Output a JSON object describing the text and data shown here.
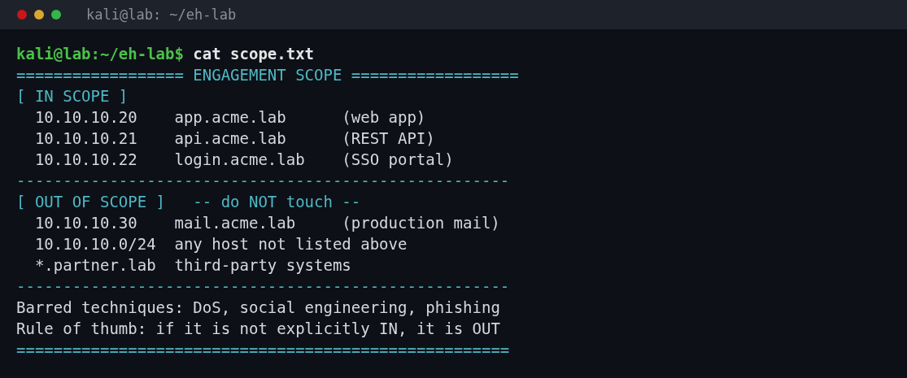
{
  "window": {
    "title": "kali@lab: ~/eh-lab"
  },
  "lines": [
    {
      "kind": "prompt",
      "prompt": "kali@lab:~/eh-lab$",
      "command": "cat scope.txt"
    },
    {
      "kind": "rule",
      "text": "================== ENGAGEMENT SCOPE =================="
    },
    {
      "kind": "heading",
      "text": "[ IN SCOPE ]"
    },
    {
      "kind": "entry",
      "ip": "10.10.10.20",
      "host": "app.acme.lab",
      "note": "(web app)"
    },
    {
      "kind": "entry",
      "ip": "10.10.10.21",
      "host": "api.acme.lab",
      "note": "(REST API)"
    },
    {
      "kind": "entry",
      "ip": "10.10.10.22",
      "host": "login.acme.lab",
      "note": "(SSO portal)"
    },
    {
      "kind": "rule",
      "text": "-----------------------------------------------------"
    },
    {
      "kind": "heading",
      "text": "[ OUT OF SCOPE ]",
      "note": "-- do NOT touch --"
    },
    {
      "kind": "entry",
      "ip": "10.10.10.30",
      "host": "mail.acme.lab",
      "note": "(production mail)"
    },
    {
      "kind": "entry",
      "ip": "10.10.10.0/24",
      "host": "any host not listed above"
    },
    {
      "kind": "entry",
      "ip": "*.partner.lab",
      "host": "third-party systems"
    },
    {
      "kind": "rule",
      "text": "-----------------------------------------------------"
    },
    {
      "kind": "text",
      "text": "Barred techniques: DoS, social engineering, phishing"
    },
    {
      "kind": "text",
      "text": "Rule of thumb: if it is not explicitly IN, it is OUT"
    },
    {
      "kind": "rule",
      "text": "====================================================="
    }
  ]
}
